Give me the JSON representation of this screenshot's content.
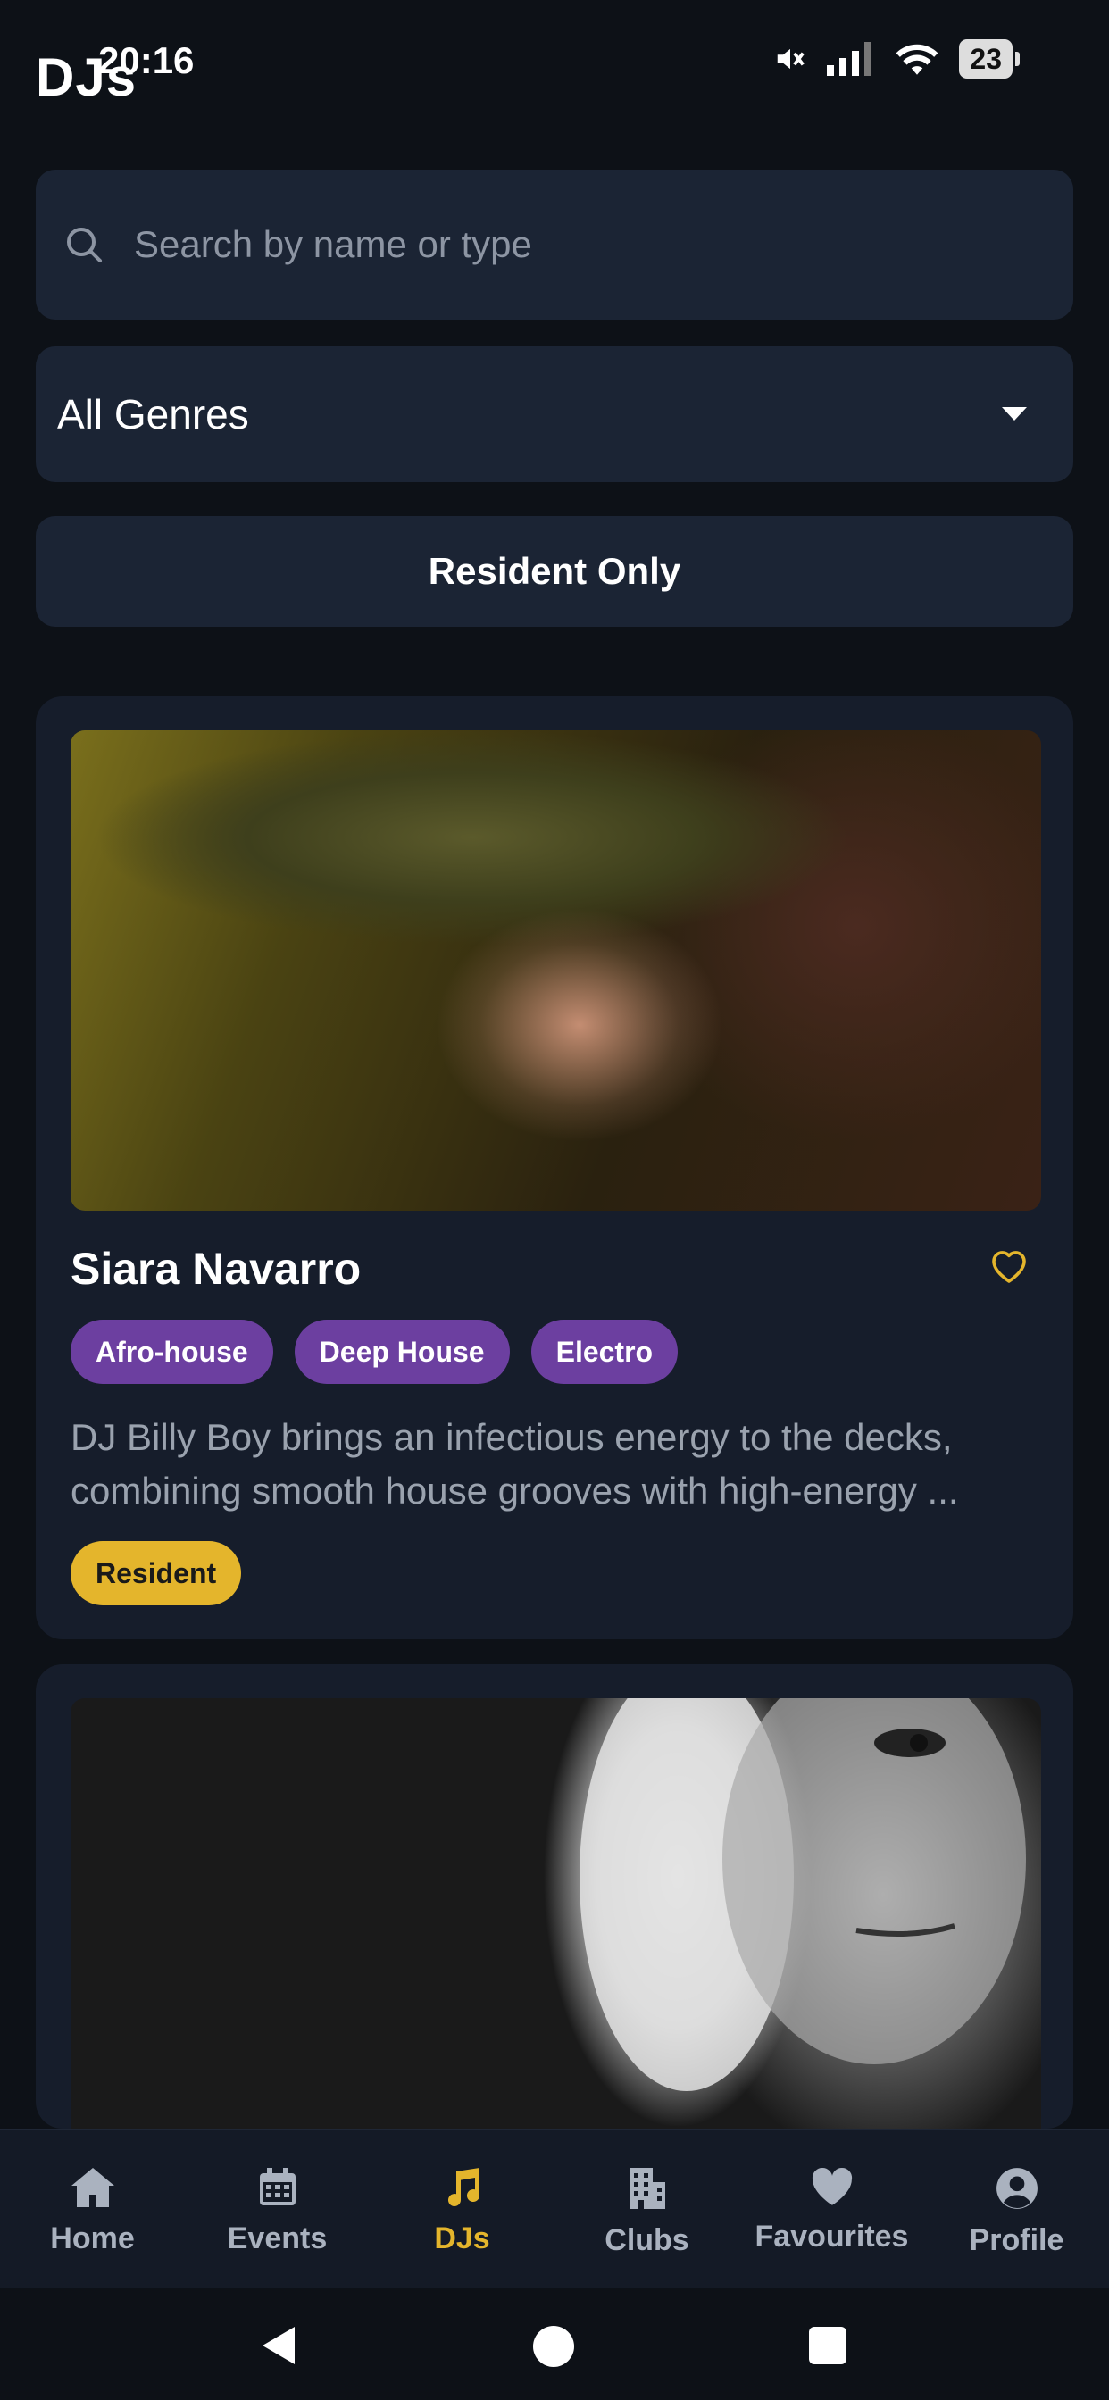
{
  "status_bar": {
    "time": "20:16",
    "battery": "23"
  },
  "header": {
    "title": "DJs"
  },
  "search": {
    "placeholder": "Search by name or type"
  },
  "genre_filter": {
    "selected": "All Genres"
  },
  "resident_filter": {
    "label": "Resident Only"
  },
  "djs": [
    {
      "name": "Siara Navarro",
      "genres": [
        "Afro-house",
        "Deep House",
        "Electro"
      ],
      "bio_line1": "DJ Billy Boy brings an infectious energy to the decks,",
      "bio_line2": "combining smooth house grooves with high-energy ...",
      "badge": "Resident",
      "favourite_icon": "heart-outline-icon"
    },
    {
      "photo": "black and white portrait of man covering one eye with hand"
    }
  ],
  "bottom_nav": [
    {
      "label": "Home",
      "icon": "home-icon"
    },
    {
      "label": "Events",
      "icon": "calendar-icon"
    },
    {
      "label": "DJs",
      "icon": "music-note-icon",
      "active": true
    },
    {
      "label": "Clubs",
      "icon": "building-icon"
    },
    {
      "label": "Favourites",
      "icon": "heart-icon"
    },
    {
      "label": "Profile",
      "icon": "user-circle-icon"
    }
  ],
  "colors": {
    "background": "#0d1117",
    "surface": "#1b2434",
    "card": "#161d2b",
    "accent": "#e4b52c",
    "tag": "#6c3fa0"
  }
}
